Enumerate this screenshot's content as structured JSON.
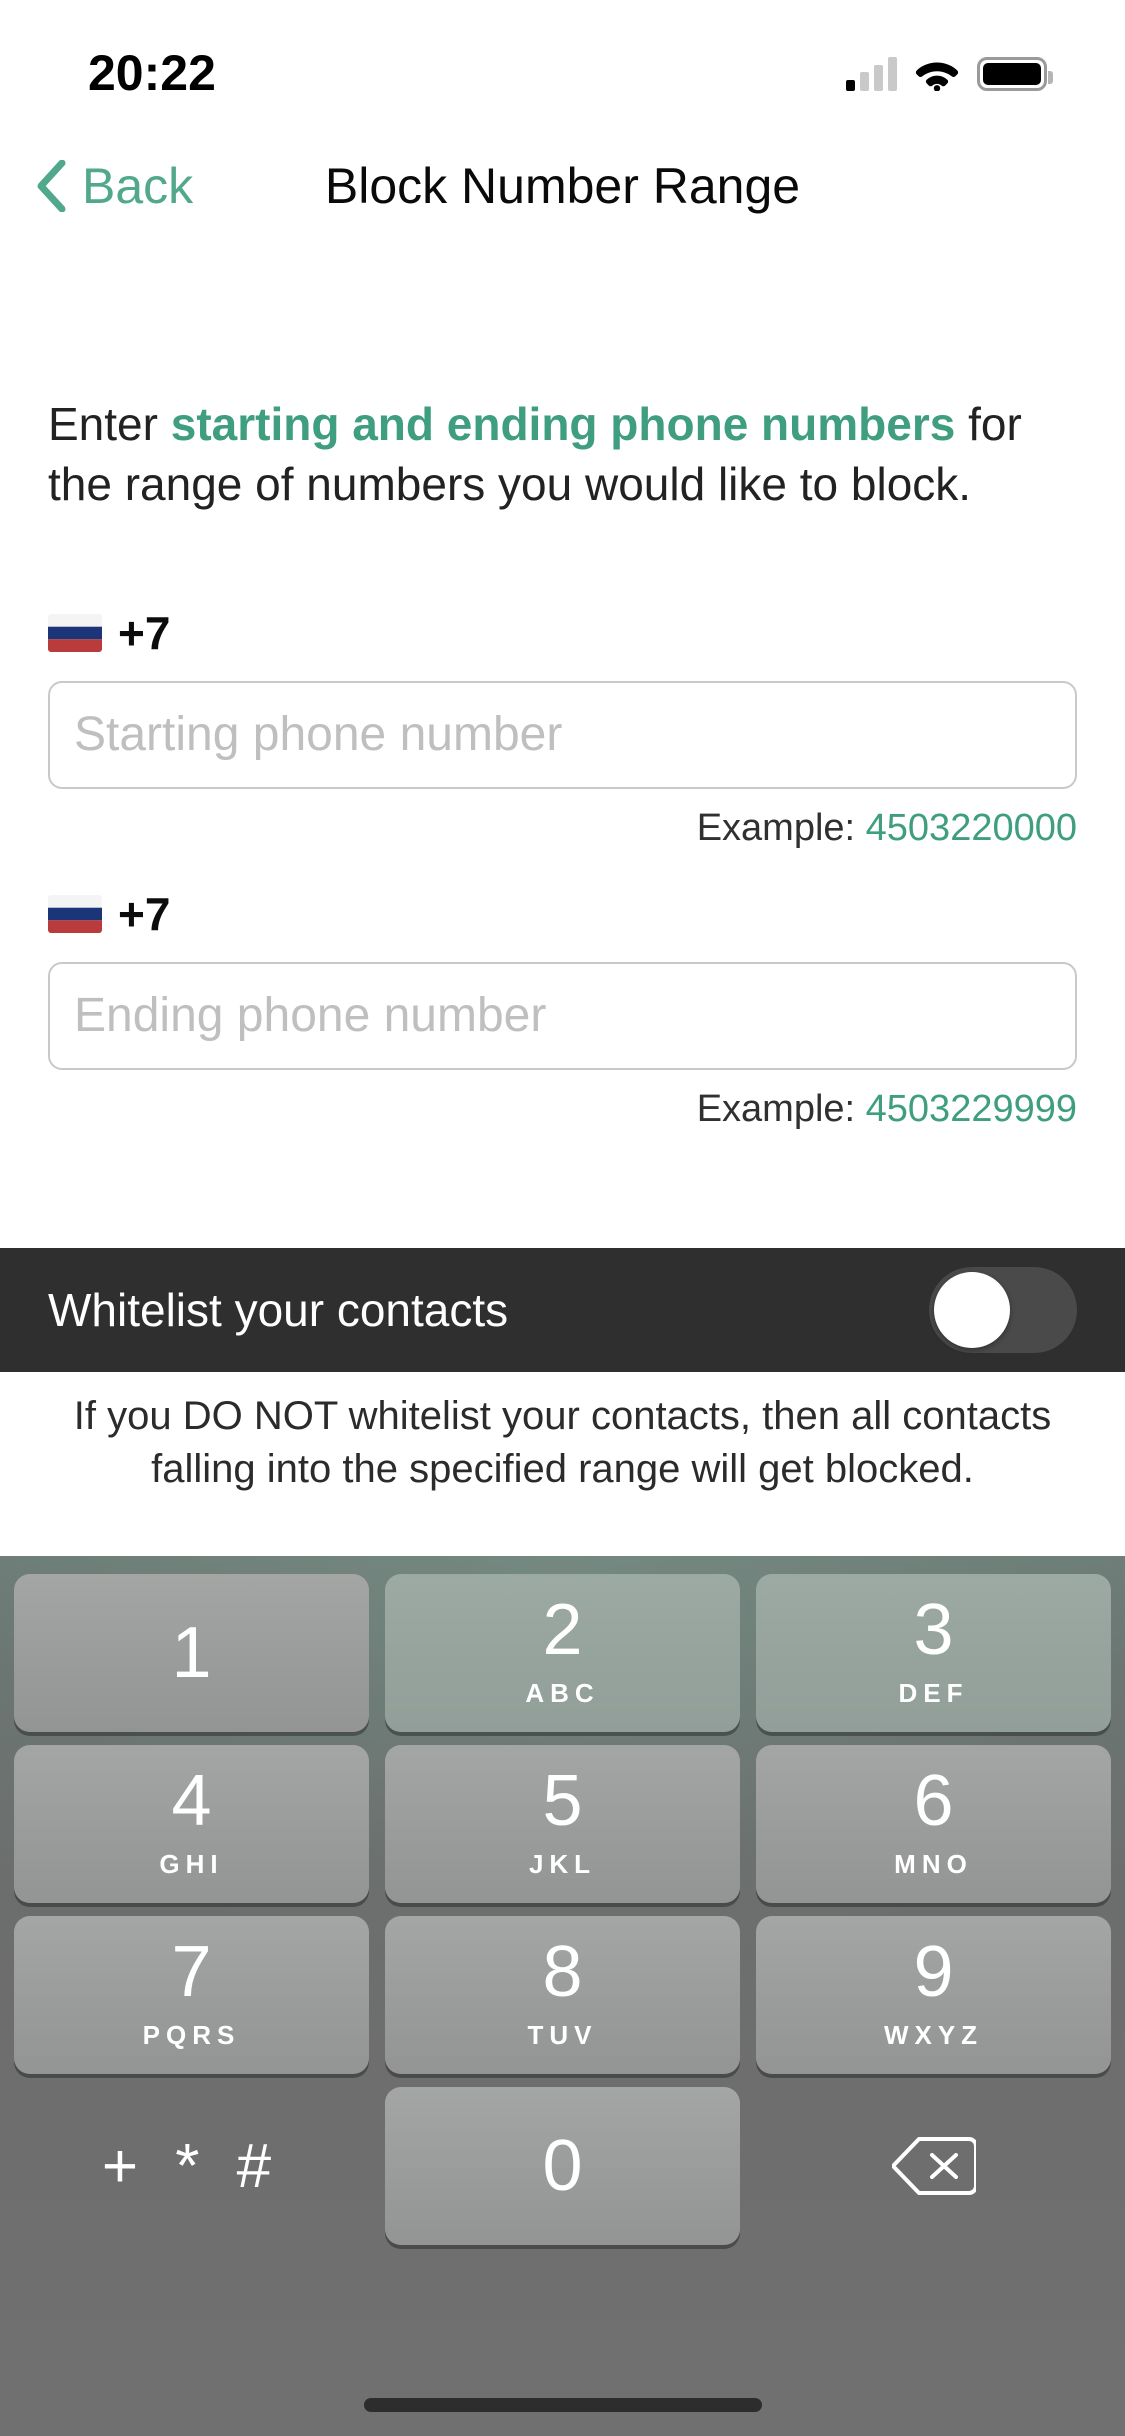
{
  "status_bar": {
    "time": "20:22",
    "signal_icon": "cellular-signal-icon",
    "signal_bars_filled": 1,
    "signal_bars_total": 4,
    "wifi_icon": "wifi-icon",
    "battery_icon": "battery-icon",
    "battery_level": "full"
  },
  "nav": {
    "back_label": "Back",
    "back_icon": "chevron-left-icon",
    "title": "Block Number Range"
  },
  "intro": {
    "before": "Enter ",
    "highlight": "starting and ending phone numbers",
    "after": " for the range of numbers you would like to block."
  },
  "fields": {
    "start": {
      "flag_icon": "flag-russia-icon",
      "country_code": "+7",
      "placeholder": "Starting phone number",
      "value": "",
      "example_label": "Example: ",
      "example_value": "4503220000"
    },
    "end": {
      "flag_icon": "flag-russia-icon",
      "country_code": "+7",
      "placeholder": "Ending phone number",
      "value": "",
      "example_label": "Example: ",
      "example_value": "4503229999"
    }
  },
  "whitelist": {
    "label": "Whitelist your contacts",
    "toggle_state": "off",
    "note": "If you DO NOT whitelist your contacts, then all contacts falling into the specified range will get blocked."
  },
  "keypad": {
    "keys": [
      {
        "digit": "1",
        "letters": ""
      },
      {
        "digit": "2",
        "letters": "ABC"
      },
      {
        "digit": "3",
        "letters": "DEF"
      },
      {
        "digit": "4",
        "letters": "GHI"
      },
      {
        "digit": "5",
        "letters": "JKL"
      },
      {
        "digit": "6",
        "letters": "MNO"
      },
      {
        "digit": "7",
        "letters": "PQRS"
      },
      {
        "digit": "8",
        "letters": "TUV"
      },
      {
        "digit": "9",
        "letters": "WXYZ"
      }
    ],
    "symbols_key": "+ * #",
    "zero_key": "0",
    "delete_icon": "delete-backspace-icon"
  },
  "colors": {
    "accent_teal": "#3f9e80",
    "back_teal": "#52a88c",
    "whitelist_bar_bg": "#2f2f2f",
    "keypad_bg": "#6e6e6e",
    "key_bg": "#9a9c9b"
  }
}
